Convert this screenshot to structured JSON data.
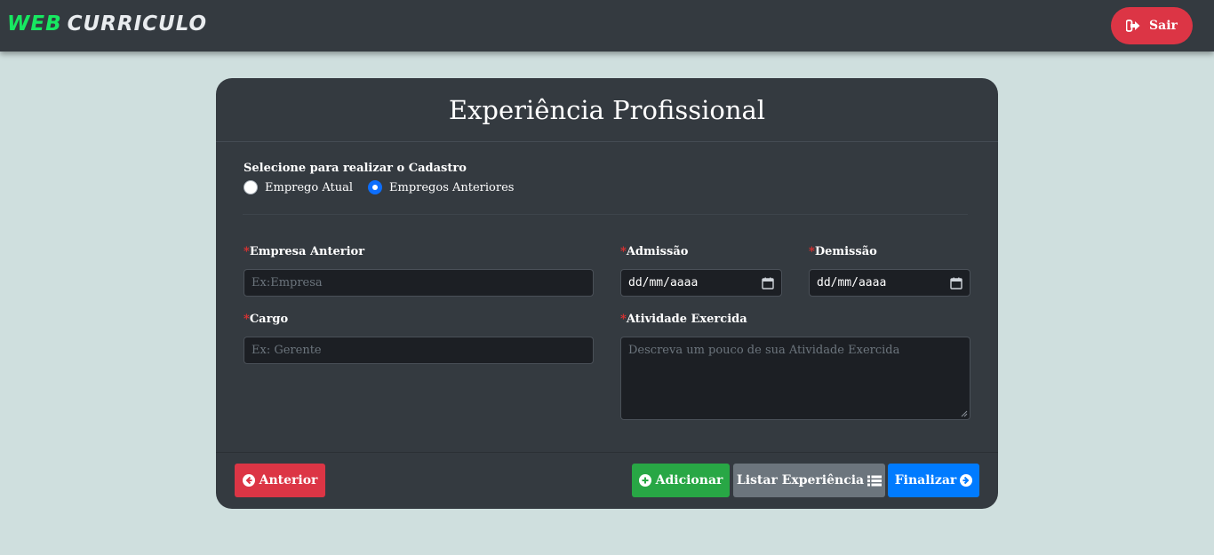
{
  "navbar": {
    "logo_part1": "WEB",
    "logo_part2": "CURRICULO",
    "logout_label": "Sair"
  },
  "card": {
    "title": "Experiência Profissional",
    "select_label": "Selecione para realizar o Cadastro",
    "radio_options": [
      {
        "label": "Emprego Atual",
        "checked": false
      },
      {
        "label": "Empregos Anteriores",
        "checked": true
      }
    ]
  },
  "form": {
    "required_mark": "*",
    "empresa": {
      "label": "Empresa Anterior",
      "placeholder": "Ex:Empresa"
    },
    "admissao": {
      "label": "Admissão",
      "value": "dd/mm/aaaa"
    },
    "demissao": {
      "label": "Demissão",
      "value": "dd/mm/aaaa"
    },
    "cargo": {
      "label": "Cargo",
      "placeholder": "Ex: Gerente"
    },
    "atividade": {
      "label": "Atividade Exercida",
      "placeholder": "Descreva um pouco de sua Atividade Exercida"
    }
  },
  "buttons": {
    "anterior": "Anterior",
    "adicionar": "Adicionar",
    "listar": "Listar Experiência",
    "finalizar": "Finalizar"
  },
  "colors": {
    "background": "#cfdfde",
    "navbar": "#343a40",
    "logo_accent": "#17e861",
    "danger": "#dc3545",
    "success": "#28a745",
    "secondary": "#6c757d",
    "primary": "#007bff"
  }
}
